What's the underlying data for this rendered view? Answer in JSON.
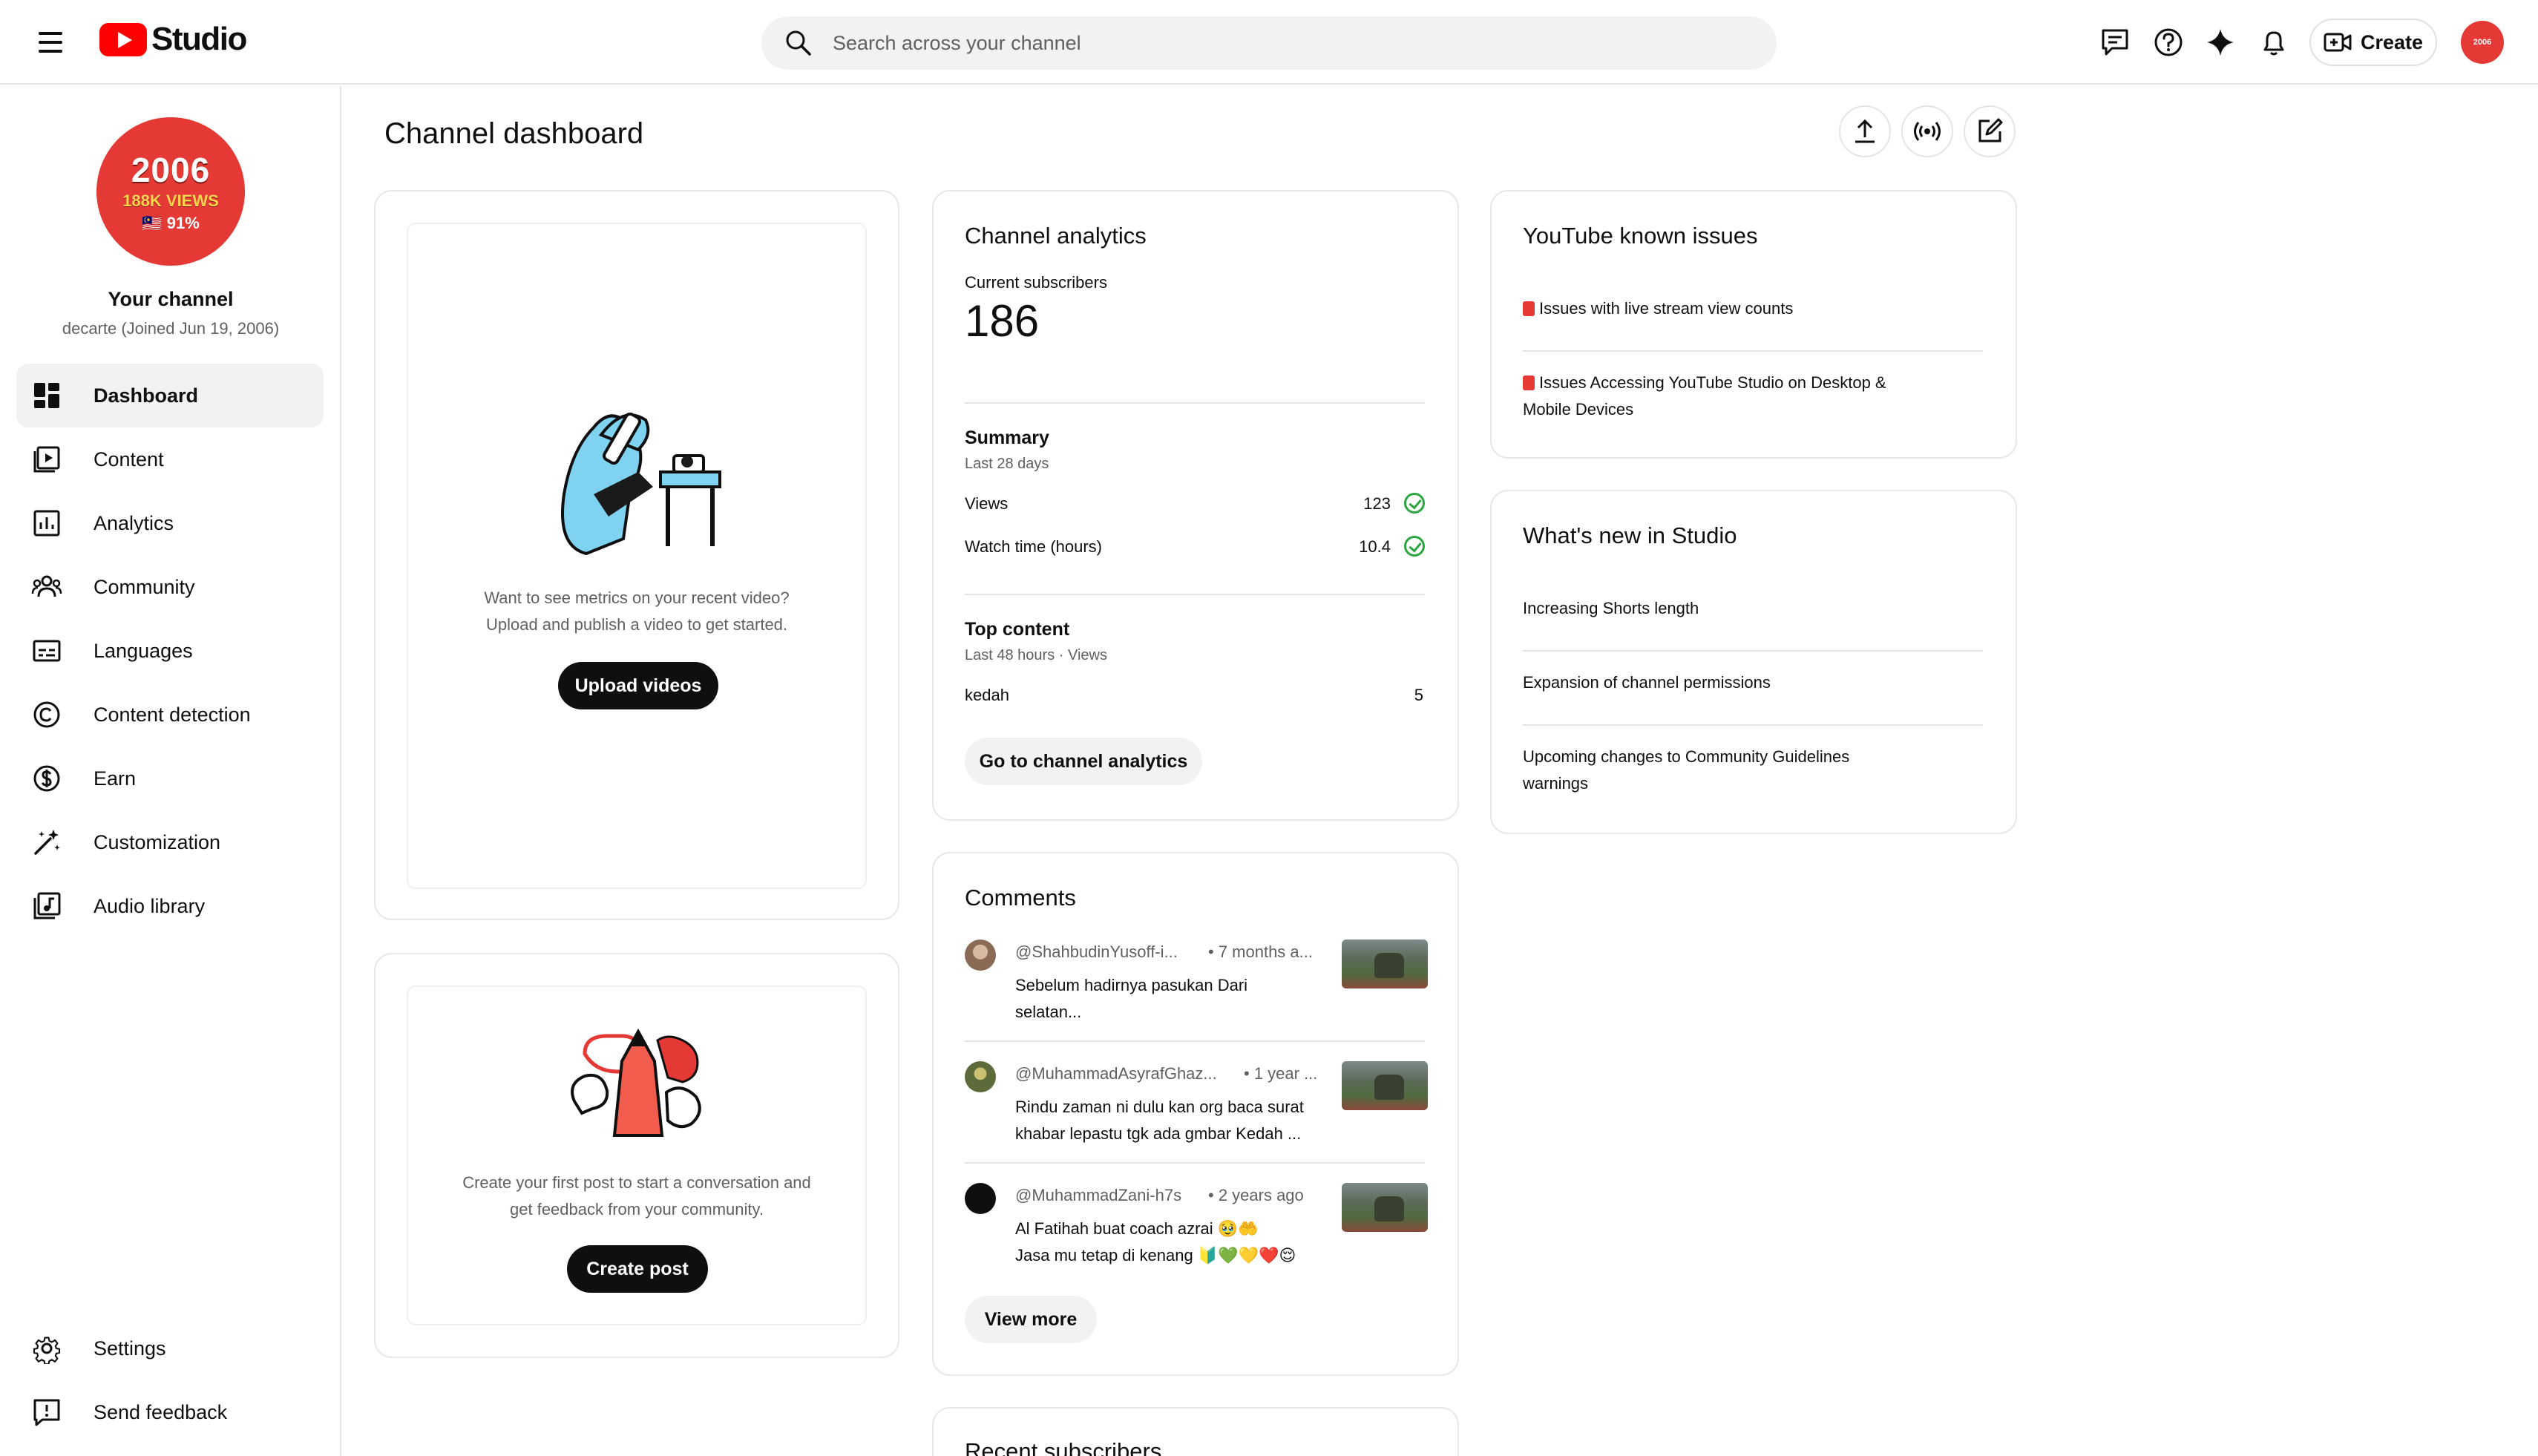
{
  "header": {
    "logo_text": "Studio",
    "search_placeholder": "Search across your channel",
    "create_label": "Create",
    "avatar_text": "2006"
  },
  "sidebar": {
    "avatar": {
      "line1": "2006",
      "line2": "188K VIEWS",
      "line3": "🇲🇾 91%"
    },
    "channel_title": "Your channel",
    "channel_subtitle": "decarte (Joined Jun 19, 2006)",
    "items": [
      {
        "label": "Dashboard",
        "icon": "dashboard-icon",
        "active": true
      },
      {
        "label": "Content",
        "icon": "content-icon"
      },
      {
        "label": "Analytics",
        "icon": "analytics-icon"
      },
      {
        "label": "Community",
        "icon": "community-icon"
      },
      {
        "label": "Languages",
        "icon": "subtitles-icon"
      },
      {
        "label": "Content detection",
        "icon": "copyright-icon"
      },
      {
        "label": "Earn",
        "icon": "dollar-icon"
      },
      {
        "label": "Customization",
        "icon": "magic-wand-icon"
      },
      {
        "label": "Audio library",
        "icon": "audio-library-icon"
      }
    ],
    "bottom_items": [
      {
        "label": "Settings",
        "icon": "gear-icon"
      },
      {
        "label": "Send feedback",
        "icon": "feedback-icon"
      }
    ]
  },
  "main": {
    "title": "Channel dashboard",
    "upload_card": {
      "text_line1": "Want to see metrics on your recent video?",
      "text_line2": "Upload and publish a video to get started.",
      "button": "Upload videos"
    },
    "post_card": {
      "text_line1": "Create your first post to start a conversation and",
      "text_line2": "get feedback from your community.",
      "button": "Create post"
    },
    "analytics": {
      "title": "Channel analytics",
      "subscribers_label": "Current subscribers",
      "subscribers_value": "186",
      "summary_title": "Summary",
      "summary_period": "Last 28 days",
      "metrics": [
        {
          "label": "Views",
          "value": "123"
        },
        {
          "label": "Watch time (hours)",
          "value": "10.4"
        }
      ],
      "top_content_title": "Top content",
      "top_content_period": "Last 48 hours · Views",
      "top_items": [
        {
          "label": "kedah",
          "value": "5"
        }
      ],
      "button": "Go to channel analytics"
    },
    "comments": {
      "title": "Comments",
      "items": [
        {
          "author": "@ShahbudinYusoff-i...",
          "time": "• 7 months a...",
          "line1": "Sebelum hadirnya pasukan Dari",
          "line2": "selatan..."
        },
        {
          "author": "@MuhammadAsyrafGhaz...",
          "time": "• 1 year ...",
          "line1": "Rindu zaman ni dulu kan org baca surat",
          "line2": "khabar lepastu tgk ada gmbar Kedah ..."
        },
        {
          "author": "@MuhammadZani-h7s",
          "time": "• 2 years ago",
          "line1": "Al Fatihah buat coach azrai 🥹🤲",
          "line2": "Jasa mu tetap di kenang 🔰💚💛❤️😌"
        }
      ],
      "button": "View more"
    },
    "recent_subscribers_title": "Recent subscribers",
    "known_issues": {
      "title": "YouTube known issues",
      "items": [
        "Issues with live stream view counts",
        "Issues Accessing YouTube Studio on Desktop & Mobile Devices"
      ]
    },
    "whats_new": {
      "title": "What's new in Studio",
      "items": [
        "Increasing Shorts length",
        "Expansion of channel permissions",
        "Upcoming changes to Community Guidelines warnings"
      ]
    }
  }
}
